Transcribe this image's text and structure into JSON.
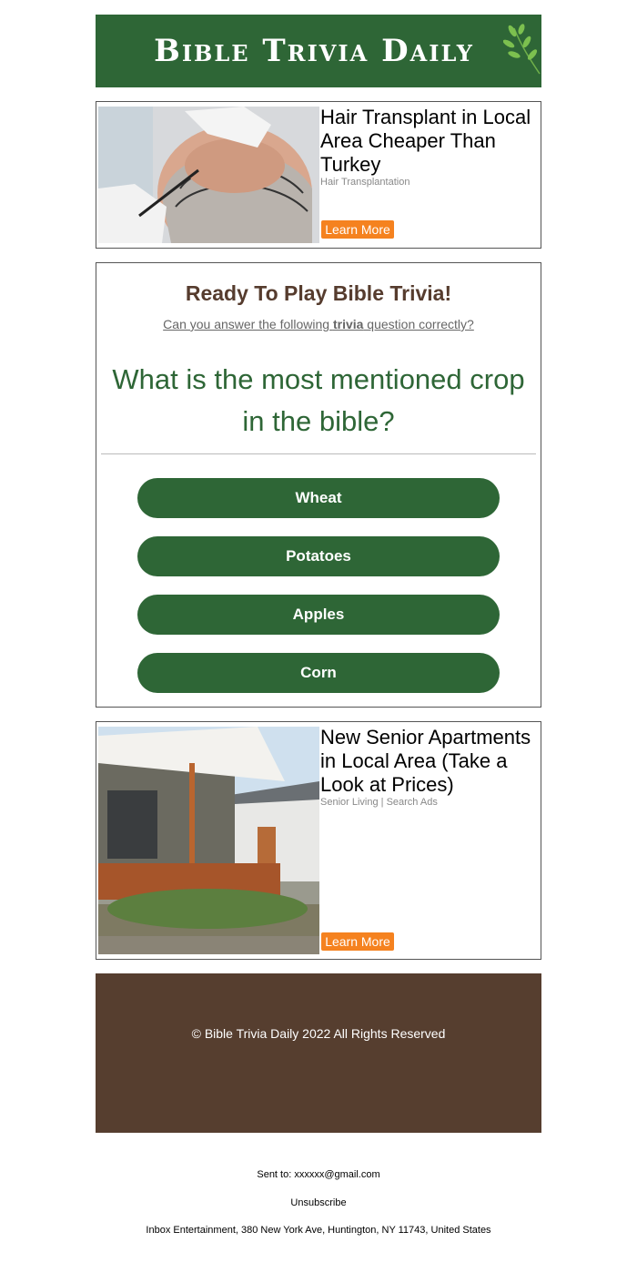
{
  "header": {
    "logo_text": "Bible Trivia Daily",
    "brand_color": "#2e6636"
  },
  "ad1": {
    "title": "Hair Transplant in Local Area Cheaper Than Turkey",
    "sponsor": "Hair Transplantation",
    "button_label": "Learn More",
    "image_icon": "hair-transplant-photo"
  },
  "quiz": {
    "heading": "Ready To Play Bible Trivia!",
    "subheading_before": "Can you answer the following ",
    "subheading_bold": "trivia",
    "subheading_after": " question correctly?",
    "question": "What is the most mentioned crop in the bible?",
    "answers": [
      "Wheat",
      "Potatoes",
      "Apples",
      "Corn"
    ]
  },
  "ad2": {
    "title": "New Senior Apartments in Local Area (Take a Look at Prices)",
    "sponsor": "Senior Living | Search Ads",
    "button_label": "Learn More",
    "image_icon": "senior-apartment-photo"
  },
  "footer": {
    "copyright": "© Bible Trivia Daily 2022 All Rights Reserved"
  },
  "meta": {
    "sent_to_label": "Sent to: ",
    "sent_to_email": "xxxxxx@gmail.com",
    "unsubscribe": "Unsubscribe",
    "address": "Inbox Entertainment, 380 New York Ave, Huntington, NY 11743, United States"
  },
  "colors": {
    "accent_green": "#2e6636",
    "footer_brown": "#563e2f",
    "ad_button_orange": "#f5821f"
  }
}
